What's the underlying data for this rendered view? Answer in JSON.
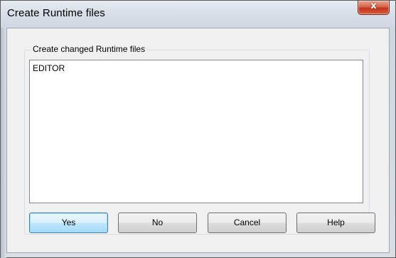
{
  "window": {
    "title": "Create Runtime files",
    "close_glyph": "x"
  },
  "group": {
    "label": "Create changed Runtime files"
  },
  "list": {
    "items": [
      "EDITOR"
    ]
  },
  "buttons": {
    "yes": "Yes",
    "no": "No",
    "cancel": "Cancel",
    "help": "Help"
  },
  "icons": {
    "close": "close-icon"
  },
  "colors": {
    "close_button": "#c2361e",
    "default_button_border": "#3c7fb1"
  }
}
